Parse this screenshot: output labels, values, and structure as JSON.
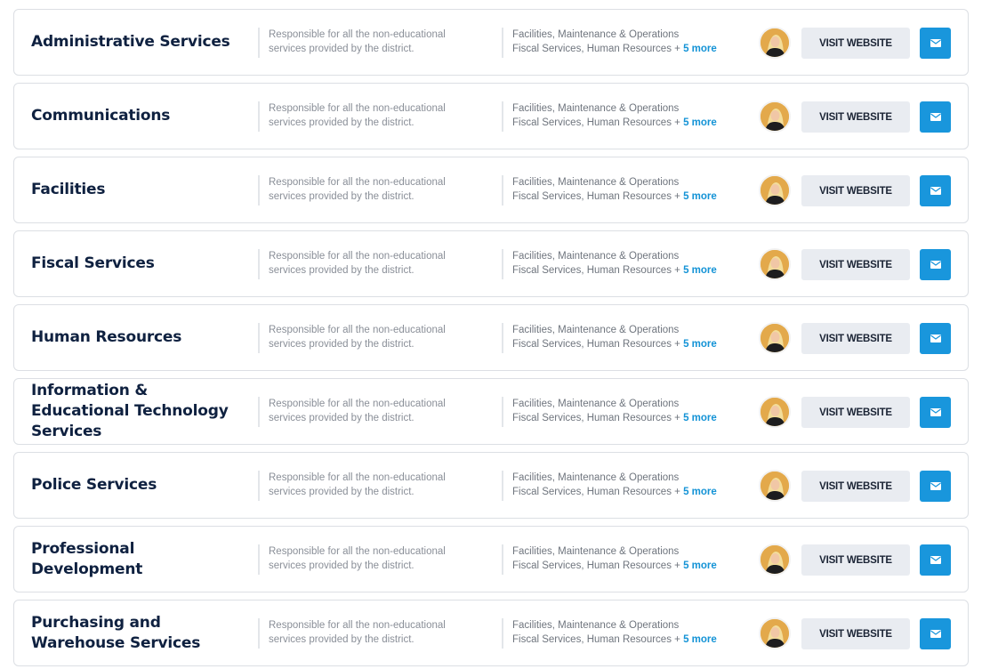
{
  "departments": [
    {
      "name": "Administrative Services",
      "description": [
        "Responsible for all the non-educational",
        "services provided by the district."
      ],
      "tags_line1": "Facilities, Maintenance & Operations",
      "tags_line2": "Fiscal Services, Human Resources +",
      "more": "5 more",
      "visit_label": "VISIT WEBSITE"
    },
    {
      "name": "Communications",
      "description": [
        "Responsible for all the non-educational",
        "services provided by the district."
      ],
      "tags_line1": "Facilities, Maintenance & Operations",
      "tags_line2": "Fiscal Services, Human Resources +",
      "more": "5 more",
      "visit_label": "VISIT WEBSITE"
    },
    {
      "name": "Facilities",
      "description": [
        "Responsible for all the non-educational",
        "services provided by the district."
      ],
      "tags_line1": "Facilities, Maintenance & Operations",
      "tags_line2": "Fiscal Services, Human Resources +",
      "more": "5 more",
      "visit_label": "VISIT WEBSITE"
    },
    {
      "name": "Fiscal Services",
      "description": [
        "Responsible for all the non-educational",
        "services provided by the district."
      ],
      "tags_line1": "Facilities, Maintenance & Operations",
      "tags_line2": "Fiscal Services, Human Resources +",
      "more": "5 more",
      "visit_label": "VISIT WEBSITE"
    },
    {
      "name": "Human Resources",
      "description": [
        "Responsible for all the non-educational",
        "services provided by the district."
      ],
      "tags_line1": "Facilities, Maintenance & Operations",
      "tags_line2": "Fiscal Services, Human Resources +",
      "more": "5 more",
      "visit_label": "VISIT WEBSITE"
    },
    {
      "name": "Information & Educational Technology Services",
      "description": [
        "Responsible for all the non-educational",
        "services provided by the district."
      ],
      "tags_line1": "Facilities, Maintenance & Operations",
      "tags_line2": "Fiscal Services, Human Resources +",
      "more": "5 more",
      "visit_label": "VISIT WEBSITE"
    },
    {
      "name": "Police Services",
      "description": [
        "Responsible for all the non-educational",
        "services provided by the district."
      ],
      "tags_line1": "Facilities, Maintenance & Operations",
      "tags_line2": "Fiscal Services, Human Resources +",
      "more": "5 more",
      "visit_label": "VISIT WEBSITE"
    },
    {
      "name": "Professional Development",
      "description": [
        "Responsible for all the non-educational",
        "services provided by the district."
      ],
      "tags_line1": "Facilities, Maintenance & Operations",
      "tags_line2": "Fiscal Services, Human Resources +",
      "more": "5 more",
      "visit_label": "VISIT WEBSITE"
    },
    {
      "name": "Purchasing and Warehouse Services",
      "description": [
        "Responsible for all the non-educational",
        "services provided by the district."
      ],
      "tags_line1": "Facilities, Maintenance & Operations",
      "tags_line2": "Fiscal Services, Human Resources +",
      "more": "5 more",
      "visit_label": "VISIT WEBSITE"
    }
  ],
  "icons": {
    "avatar": "person-avatar",
    "mail": "envelope-icon"
  },
  "colors": {
    "accent": "#1996dc",
    "title": "#0f2140",
    "button_bg": "#e9ecf1"
  }
}
